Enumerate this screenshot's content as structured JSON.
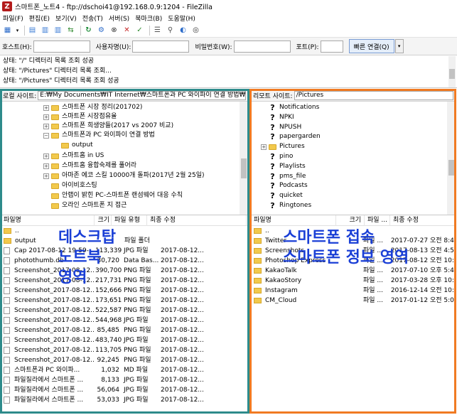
{
  "window": {
    "title": "스마트폰_노트4 - ftp://dschoi41@192.168.0.9:1204 - FileZilla",
    "app_icon": "Z"
  },
  "menu": [
    "파일(F)",
    "편집(E)",
    "보기(V)",
    "전송(T)",
    "서버(S)",
    "북마크(B)",
    "도움말(H)"
  ],
  "quickconnect": {
    "host_label": "호스트(H):",
    "user_label": "사용자명(U):",
    "pass_label": "비밀번호(W):",
    "port_label": "포트(P):",
    "connect_label": "빠른 연결(Q)",
    "dropdown": "▾"
  },
  "log": [
    "상태:  \"/\" 디렉터리 목록 조회 성공",
    "상태:  \"/Pictures\" 디렉터리 목록 조회...",
    "상태:  \"/Pictures\" 디렉터리 목록 조회 성공"
  ],
  "local": {
    "site_label": "로컬 사이트:",
    "site_path": "E:₩My Documents₩IT Internet₩스마트폰과 PC 와이파이 연결 방법₩",
    "tree": [
      {
        "label": "스마트폰 시장 정리(201702)",
        "level": 1,
        "expander": "+"
      },
      {
        "label": "스마트폰 시장점유율",
        "level": 1,
        "expander": "+"
      },
      {
        "label": "스마트폰 희생양들(2017 vs 2007 비교)",
        "level": 1,
        "expander": "+"
      },
      {
        "label": "스마트폰과 PC 와이파이 연결 방법",
        "level": 1,
        "expander": "−"
      },
      {
        "label": "output",
        "level": 2,
        "expander": ""
      },
      {
        "label": "스마트홈 in US",
        "level": 1,
        "expander": "+"
      },
      {
        "label": "스마트홈 융합숙제를 풀어라",
        "level": 1,
        "expander": "+"
      },
      {
        "label": "아마존 에코 스킬 10000개 돌파(2017년 2월 25일)",
        "level": 1,
        "expander": "+"
      },
      {
        "label": "아이비호스팅",
        "level": 1,
        "expander": ""
      },
      {
        "label": "안랩이 밝힌 PC-스마트폰 랜섬웨어 대응 수칙",
        "level": 1,
        "expander": ""
      },
      {
        "label": "오라인 스마트폰 지 접근",
        "level": 1,
        "expander": ""
      }
    ],
    "columns": [
      "파일명",
      "크기",
      "파일 유형",
      "최종 수정"
    ],
    "files": [
      {
        "name": "..",
        "size": "",
        "type": "",
        "modified": "",
        "kind": "folder"
      },
      {
        "name": "output",
        "size": "",
        "type": "파일 폴더",
        "modified": "",
        "kind": "folder"
      },
      {
        "name": "Cap 2017-08-12 19-59-...",
        "size": "113,339",
        "type": "JPG 파일",
        "modified": "2017-08-12...",
        "kind": "file"
      },
      {
        "name": "photothumb.db",
        "size": "30,720",
        "type": "Data Bas...",
        "modified": "2017-08-12...",
        "kind": "file"
      },
      {
        "name": "Screenshot_2017-08-12...",
        "size": "390,700",
        "type": "PNG 파일",
        "modified": "2017-08-12...",
        "kind": "file"
      },
      {
        "name": "Screenshot_2017-08-12...",
        "size": "217,731",
        "type": "PNG 파일",
        "modified": "2017-08-12...",
        "kind": "file"
      },
      {
        "name": "Screenshot_2017-08-12...",
        "size": "152,666",
        "type": "PNG 파일",
        "modified": "2017-08-12...",
        "kind": "file"
      },
      {
        "name": "Screenshot_2017-08-12...",
        "size": "173,651",
        "type": "PNG 파일",
        "modified": "2017-08-12...",
        "kind": "file"
      },
      {
        "name": "Screenshot_2017-08-12...",
        "size": "522,587",
        "type": "PNG 파일",
        "modified": "2017-08-12...",
        "kind": "file"
      },
      {
        "name": "Screenshot_2017-08-12...",
        "size": "544,968",
        "type": "JPG 파일",
        "modified": "2017-08-12...",
        "kind": "file"
      },
      {
        "name": "Screenshot_2017-08-12...",
        "size": "85,485",
        "type": "PNG 파일",
        "modified": "2017-08-12...",
        "kind": "file"
      },
      {
        "name": "Screenshot_2017-08-12...",
        "size": "483,740",
        "type": "JPG 파일",
        "modified": "2017-08-12...",
        "kind": "file"
      },
      {
        "name": "Screenshot_2017-08-12...",
        "size": "113,705",
        "type": "PNG 파일",
        "modified": "2017-08-12...",
        "kind": "file"
      },
      {
        "name": "Screenshot_2017-08-12...",
        "size": "92,245",
        "type": "PNG 파일",
        "modified": "2017-08-12...",
        "kind": "file"
      },
      {
        "name": "스마트폰과 PC 와이파...",
        "size": "1,032",
        "type": "MD 파일",
        "modified": "2017-08-12...",
        "kind": "file"
      },
      {
        "name": "파일질라에서 스마트폰 ...",
        "size": "8,133",
        "type": "JPG 파일",
        "modified": "2017-08-12...",
        "kind": "file"
      },
      {
        "name": "파일질라에서 스마트폰 ...",
        "size": "56,064",
        "type": "JPG 파일",
        "modified": "2017-08-12...",
        "kind": "file"
      },
      {
        "name": "파일질라에서 스마트폰 ...",
        "size": "53,033",
        "type": "JPG 파일",
        "modified": "2017-08-12...",
        "kind": "file"
      }
    ]
  },
  "remote": {
    "site_label": "리모트 사이트:",
    "site_path": "/Pictures",
    "tree": [
      {
        "label": "Notifications",
        "icon": "?",
        "expander": ""
      },
      {
        "label": "NPKI",
        "icon": "?",
        "expander": ""
      },
      {
        "label": "NPUSH",
        "icon": "?",
        "expander": ""
      },
      {
        "label": "papergarden",
        "icon": "?",
        "expander": ""
      },
      {
        "label": "Pictures",
        "icon": "folder",
        "expander": "+"
      },
      {
        "label": "pino",
        "icon": "?",
        "expander": ""
      },
      {
        "label": "Playlists",
        "icon": "?",
        "expander": ""
      },
      {
        "label": "pms_file",
        "icon": "?",
        "expander": ""
      },
      {
        "label": "Podcasts",
        "icon": "?",
        "expander": ""
      },
      {
        "label": "quicket",
        "icon": "?",
        "expander": ""
      },
      {
        "label": "Ringtones",
        "icon": "?",
        "expander": ""
      }
    ],
    "columns": [
      "파일명",
      "크기",
      "파일 ...",
      "최종 수정"
    ],
    "files": [
      {
        "name": "..",
        "size": "",
        "type": "",
        "modified": ""
      },
      {
        "name": "Twitter",
        "size": "",
        "type": "파일 ...",
        "modified": "2017-07-27 오전 8:43"
      },
      {
        "name": "Screenshots",
        "size": "",
        "type": "파일 ...",
        "modified": "2017-08-13 오전 4:51"
      },
      {
        "name": "Photoshop Express",
        "size": "",
        "type": "파일 ...",
        "modified": "2017-08-12 오전 10:2"
      },
      {
        "name": "KakaoTalk",
        "size": "",
        "type": "파일 ...",
        "modified": "2017-07-10 오후 5:47"
      },
      {
        "name": "KakaoStory",
        "size": "",
        "type": "파일 ...",
        "modified": "2017-03-28 오후 10:2"
      },
      {
        "name": "Instagram",
        "size": "",
        "type": "파일 ...",
        "modified": "2016-12-14 오전 10:4"
      },
      {
        "name": "CM_Cloud",
        "size": "",
        "type": "파일 ...",
        "modified": "2017-01-12 오전 5:08"
      }
    ]
  },
  "annotations": {
    "left_line1": "데스크탑",
    "left_line2": "노트북",
    "left_line3": "영역",
    "right_line1": "스마트폰 접속",
    "right_line2": "스마트폰 정보 영역"
  },
  "colors": {
    "left_frame": "#2e8b8b",
    "right_frame": "#f07a22",
    "overlay_text": "#1a3fd6"
  }
}
